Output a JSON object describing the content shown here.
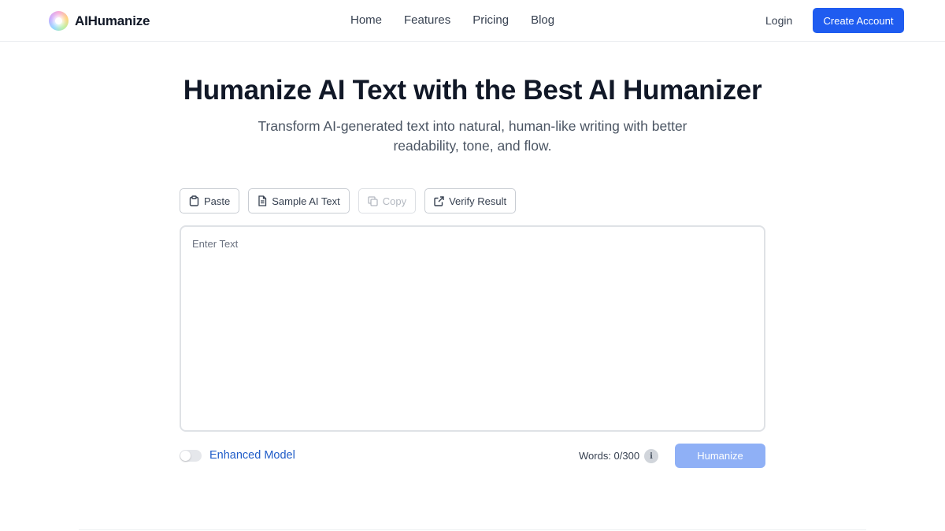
{
  "header": {
    "brand": "AIHumanize",
    "nav": [
      "Home",
      "Features",
      "Pricing",
      "Blog"
    ],
    "login": "Login",
    "create_account": "Create Account"
  },
  "hero": {
    "title": "Humanize AI Text with the Best AI Humanizer",
    "subtitle": "Transform AI-generated text into natural, human-like writing with better readability, tone, and flow."
  },
  "toolbar": {
    "paste": "Paste",
    "sample": "Sample AI Text",
    "copy": "Copy",
    "verify": "Verify Result"
  },
  "editor": {
    "placeholder": "Enter Text",
    "value": ""
  },
  "controls": {
    "enhanced_model_label": "Enhanced Model",
    "enhanced_model_on": false,
    "words_label": "Words: 0/300",
    "info_glyph": "i",
    "humanize": "Humanize"
  },
  "colors": {
    "accent": "#1f5cf0",
    "accent_disabled": "#8fb0f6",
    "link": "#1f5cc8"
  }
}
